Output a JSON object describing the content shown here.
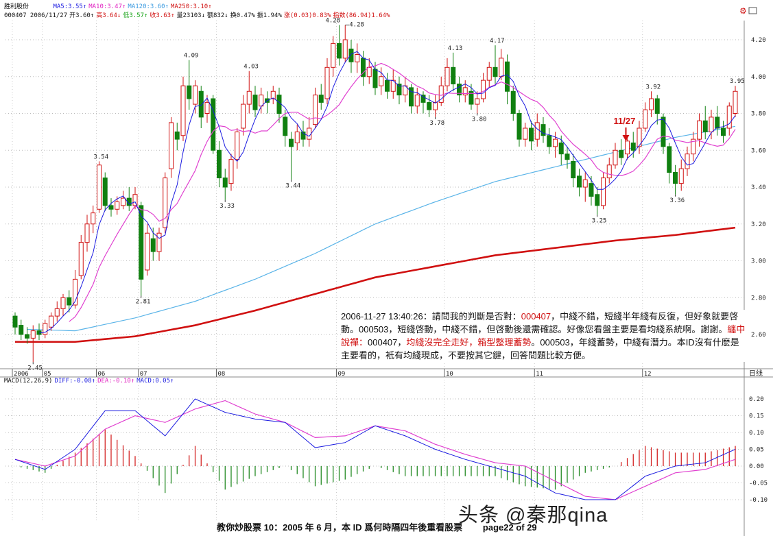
{
  "header": {
    "stock_name": "胜利股份",
    "ma_values": [
      {
        "text": "MA5:3.55↑",
        "color": "#1a1ae0"
      },
      {
        "text": "MA10:3.47↑",
        "color": "#e020c0"
      },
      {
        "text": "MA120:3.60↑",
        "color": "#3a9ae0"
      },
      {
        "text": "MA250:3.10↑",
        "color": "#d01010"
      }
    ],
    "quote_items": [
      {
        "text": "000407 2006/11/27",
        "color": "#111"
      },
      {
        "text": "开3.60↑",
        "color": "#111"
      },
      {
        "text": "高3.64↓",
        "color": "#d01010"
      },
      {
        "text": "低3.57↑",
        "color": "#10a010"
      },
      {
        "text": "收3.63↑",
        "color": "#d01010"
      },
      {
        "text": "量23103↓",
        "color": "#111"
      },
      {
        "text": "额832↓",
        "color": "#111"
      },
      {
        "text": "换0.47%",
        "color": "#111"
      },
      {
        "text": "振1.94%",
        "color": "#111"
      },
      {
        "text": "涨(0.03)0.83%",
        "color": "#d01010"
      },
      {
        "text": "指数(86.94)1.64%",
        "color": "#d01010"
      }
    ]
  },
  "macd_header": [
    {
      "text": "MACD(12,26,9)",
      "color": "#111"
    },
    {
      "text": "DIFF:-0.08↑",
      "color": "#1a1ae0"
    },
    {
      "text": "DEA:-0.10↑",
      "color": "#e020c0"
    },
    {
      "text": "MACD:0.05↑",
      "color": "#1a1ae0"
    }
  ],
  "period_label": "日线",
  "marker": {
    "text": "11/27",
    "index": 102,
    "color": "#d01010"
  },
  "note": {
    "segments": [
      {
        "text": "2006-11-27 13:40:26：請問我的判斷是否對：",
        "red": false
      },
      {
        "text": "000407",
        "red": true
      },
      {
        "text": "，中綫不錯，短綫半年綫有反復，但好象就要啓動。000503，短綫啓動，中綫不錯，但啓動後還需確認。好像您看盤主要是看均綫系統啊。謝謝。",
        "red": false
      },
      {
        "text": "纏中說禪：",
        "red": true
      },
      {
        "text": "000407，",
        "red": false
      },
      {
        "text": "均綫沒完全走好，箱型整理蓄勢",
        "red": true
      },
      {
        "text": "。000503，年綫蓄勢，中綫有潛力。本ID沒有什麽是主要看的，衹有均綫現成，不要按其它鍵，回答問題比較方便。",
        "red": false
      }
    ]
  },
  "footer": {
    "title": "教你炒股票 10：2005 年 6 月，本 ID 爲何時隔四年後重看股票",
    "page": "page22 of 29"
  },
  "watermark": "头条 @秦那qina",
  "colors": {
    "up": "#d01010",
    "down": "#108010",
    "ma5": "#1a1ae0",
    "ma10": "#e040d0",
    "ma120": "#5ab4e8",
    "ma250": "#d01010"
  },
  "chart_data": [
    {
      "type": "candlestick",
      "ylim": [
        2.45,
        4.28
      ],
      "y_ticks": [
        "4.20",
        "4.00",
        "3.80",
        "3.60",
        "3.40",
        "3.20",
        "3.00",
        "2.80",
        "2.60"
      ],
      "x_tick_labels": [
        {
          "index": 0,
          "text": "2006"
        },
        {
          "index": 5,
          "text": "05"
        },
        {
          "index": 14,
          "text": "06"
        },
        {
          "index": 21,
          "text": "07"
        },
        {
          "index": 34,
          "text": "08"
        },
        {
          "index": 54,
          "text": "09"
        },
        {
          "index": 72,
          "text": "10"
        },
        {
          "index": 87,
          "text": "11"
        },
        {
          "index": 105,
          "text": "12"
        }
      ],
      "ohlc_format": "[open, close, high, low]",
      "ohlc": [
        [
          2.7,
          2.64,
          2.72,
          2.6
        ],
        [
          2.65,
          2.6,
          2.68,
          2.57
        ],
        [
          2.6,
          2.58,
          2.64,
          2.55
        ],
        [
          2.58,
          2.62,
          2.65,
          2.45
        ],
        [
          2.62,
          2.6,
          2.66,
          2.57
        ],
        [
          2.6,
          2.66,
          2.68,
          2.58
        ],
        [
          2.64,
          2.7,
          2.72,
          2.62
        ],
        [
          2.7,
          2.74,
          2.78,
          2.67
        ],
        [
          2.74,
          2.8,
          2.82,
          2.7
        ],
        [
          2.8,
          2.76,
          2.84,
          2.72
        ],
        [
          2.76,
          2.9,
          2.95,
          2.74
        ],
        [
          2.92,
          3.1,
          3.14,
          2.9
        ],
        [
          3.1,
          3.2,
          3.25,
          3.05
        ],
        [
          3.2,
          3.26,
          3.3,
          3.15
        ],
        [
          3.28,
          3.52,
          3.54,
          3.26
        ],
        [
          3.45,
          3.3,
          3.48,
          3.27
        ],
        [
          3.3,
          3.28,
          3.34,
          3.24
        ],
        [
          3.28,
          3.32,
          3.35,
          3.25
        ],
        [
          3.3,
          3.34,
          3.38,
          3.28
        ],
        [
          3.34,
          3.3,
          3.4,
          3.27
        ],
        [
          3.3,
          3.36,
          3.4,
          3.28
        ],
        [
          3.3,
          2.9,
          3.32,
          2.81
        ],
        [
          2.95,
          3.15,
          3.2,
          2.92
        ],
        [
          3.12,
          3.05,
          3.18,
          3.0
        ],
        [
          3.05,
          3.15,
          3.18,
          3.0
        ],
        [
          3.18,
          3.45,
          3.48,
          3.15
        ],
        [
          3.5,
          3.75,
          3.78,
          3.45
        ],
        [
          3.7,
          3.66,
          3.75,
          3.6
        ],
        [
          3.68,
          3.95,
          4.0,
          3.65
        ],
        [
          3.95,
          3.88,
          4.09,
          3.82
        ],
        [
          3.85,
          3.95,
          3.98,
          3.8
        ],
        [
          3.92,
          3.78,
          3.95,
          3.72
        ],
        [
          3.8,
          3.86,
          3.9,
          3.75
        ],
        [
          3.88,
          3.6,
          3.9,
          3.58
        ],
        [
          3.6,
          3.45,
          3.65,
          3.4
        ],
        [
          3.45,
          3.4,
          3.5,
          3.33
        ],
        [
          3.42,
          3.55,
          3.58,
          3.38
        ],
        [
          3.55,
          3.7,
          3.72,
          3.5
        ],
        [
          3.72,
          3.85,
          3.9,
          3.68
        ],
        [
          3.85,
          3.92,
          4.03,
          3.8
        ],
        [
          3.9,
          3.82,
          3.95,
          3.78
        ],
        [
          3.84,
          3.9,
          3.94,
          3.8
        ],
        [
          3.88,
          3.86,
          3.92,
          3.8
        ],
        [
          3.88,
          3.92,
          3.95,
          3.85
        ],
        [
          3.9,
          3.8,
          3.94,
          3.75
        ],
        [
          3.78,
          3.68,
          3.82,
          3.62
        ],
        [
          3.66,
          3.62,
          3.7,
          3.44
        ],
        [
          3.64,
          3.7,
          3.74,
          3.6
        ],
        [
          3.7,
          3.66,
          3.76,
          3.62
        ],
        [
          3.66,
          3.72,
          3.78,
          3.62
        ],
        [
          3.74,
          3.9,
          3.94,
          3.72
        ],
        [
          3.9,
          3.86,
          3.96,
          3.82
        ],
        [
          3.88,
          4.05,
          4.1,
          3.85
        ],
        [
          4.05,
          4.18,
          4.22,
          4.0
        ],
        [
          4.18,
          4.1,
          4.28,
          4.06
        ],
        [
          4.1,
          4.2,
          4.28,
          4.08
        ],
        [
          4.15,
          4.08,
          4.2,
          4.02
        ],
        [
          4.08,
          4.12,
          4.18,
          4.02
        ],
        [
          4.1,
          4.0,
          4.14,
          3.95
        ],
        [
          4.0,
          4.05,
          4.1,
          3.96
        ],
        [
          4.04,
          3.94,
          4.08,
          3.9
        ],
        [
          3.95,
          4.0,
          4.05,
          3.9
        ],
        [
          3.98,
          3.92,
          4.02,
          3.88
        ],
        [
          3.92,
          3.98,
          4.04,
          3.88
        ],
        [
          3.96,
          3.9,
          4.0,
          3.85
        ],
        [
          3.9,
          3.95,
          4.0,
          3.86
        ],
        [
          3.94,
          3.84,
          3.96,
          3.8
        ],
        [
          3.84,
          3.9,
          3.94,
          3.8
        ],
        [
          3.9,
          3.86,
          3.92,
          3.8
        ],
        [
          3.86,
          3.82,
          3.9,
          3.78
        ],
        [
          3.82,
          3.86,
          3.9,
          3.78
        ],
        [
          3.86,
          3.95,
          4.0,
          3.84
        ],
        [
          3.95,
          4.05,
          4.1,
          3.92
        ],
        [
          4.05,
          3.96,
          4.13,
          3.92
        ],
        [
          3.96,
          3.9,
          4.0,
          3.86
        ],
        [
          3.9,
          3.94,
          3.98,
          3.86
        ],
        [
          3.92,
          3.85,
          3.96,
          3.82
        ],
        [
          3.85,
          3.88,
          3.92,
          3.8
        ],
        [
          3.88,
          3.98,
          4.02,
          3.86
        ],
        [
          3.98,
          4.05,
          4.08,
          3.94
        ],
        [
          4.05,
          4.0,
          4.17,
          3.96
        ],
        [
          4.0,
          4.1,
          4.15,
          3.98
        ],
        [
          4.08,
          3.92,
          4.12,
          3.85
        ],
        [
          3.92,
          3.8,
          3.95,
          3.76
        ],
        [
          3.8,
          3.66,
          3.82,
          3.62
        ],
        [
          3.66,
          3.72,
          3.75,
          3.62
        ],
        [
          3.72,
          3.65,
          3.76,
          3.6
        ],
        [
          3.66,
          3.75,
          3.8,
          3.62
        ],
        [
          3.74,
          3.68,
          3.78,
          3.64
        ],
        [
          3.68,
          3.62,
          3.72,
          3.58
        ],
        [
          3.62,
          3.66,
          3.7,
          3.56
        ],
        [
          3.64,
          3.58,
          3.68,
          3.52
        ],
        [
          3.58,
          3.55,
          3.62,
          3.5
        ],
        [
          3.54,
          3.45,
          3.58,
          3.4
        ],
        [
          3.46,
          3.4,
          3.5,
          3.35
        ],
        [
          3.4,
          3.44,
          3.48,
          3.32
        ],
        [
          3.42,
          3.35,
          3.46,
          3.3
        ],
        [
          3.36,
          3.3,
          3.4,
          3.25
        ],
        [
          3.3,
          3.45,
          3.48,
          3.28
        ],
        [
          3.45,
          3.52,
          3.56,
          3.42
        ],
        [
          3.52,
          3.6,
          3.64,
          3.5
        ],
        [
          3.6,
          3.56,
          3.66,
          3.52
        ],
        [
          3.58,
          3.65,
          3.68,
          3.55
        ],
        [
          3.64,
          3.6,
          3.7,
          3.56
        ],
        [
          3.62,
          3.72,
          3.76,
          3.58
        ],
        [
          3.72,
          3.82,
          3.86,
          3.7
        ],
        [
          3.82,
          3.88,
          3.92,
          3.78
        ],
        [
          3.88,
          3.8,
          3.9,
          3.74
        ],
        [
          3.78,
          3.62,
          3.8,
          3.58
        ],
        [
          3.62,
          3.48,
          3.64,
          3.42
        ],
        [
          3.48,
          3.42,
          3.52,
          3.36
        ],
        [
          3.42,
          3.5,
          3.55,
          3.38
        ],
        [
          3.5,
          3.58,
          3.62,
          3.46
        ],
        [
          3.58,
          3.66,
          3.7,
          3.54
        ],
        [
          3.66,
          3.76,
          3.8,
          3.62
        ],
        [
          3.76,
          3.7,
          3.84,
          3.66
        ],
        [
          3.7,
          3.78,
          3.82,
          3.66
        ],
        [
          3.78,
          3.72,
          3.84,
          3.68
        ],
        [
          3.72,
          3.68,
          3.76,
          3.64
        ],
        [
          3.72,
          3.84,
          3.86,
          3.68
        ],
        [
          3.8,
          3.92,
          3.95,
          3.78
        ]
      ],
      "ma_long": {
        "sample_every": 10,
        "ma120": [
          2.63,
          2.62,
          2.69,
          2.78,
          2.9,
          3.04,
          3.2,
          3.32,
          3.43,
          3.51,
          3.59,
          3.67,
          3.73
        ],
        "ma250": [
          2.56,
          2.56,
          2.59,
          2.65,
          2.73,
          2.82,
          2.91,
          2.97,
          3.03,
          3.07,
          3.11,
          3.14,
          3.18
        ]
      },
      "price_labels": [
        {
          "index": 3,
          "price": 2.45,
          "text": "2.45",
          "pos": "below"
        },
        {
          "index": 14,
          "price": 3.54,
          "text": "3.54",
          "pos": "above"
        },
        {
          "index": 21,
          "price": 2.81,
          "text": "2.81",
          "pos": "below"
        },
        {
          "index": 29,
          "price": 4.09,
          "text": "4.09",
          "pos": "above"
        },
        {
          "index": 35,
          "price": 3.33,
          "text": "3.33",
          "pos": "below"
        },
        {
          "index": 39,
          "price": 4.03,
          "text": "4.03",
          "pos": "above"
        },
        {
          "index": 46,
          "price": 3.44,
          "text": "3.44",
          "pos": "below"
        },
        {
          "index": 54,
          "price": 4.28,
          "text": "4.28",
          "pos": "left"
        },
        {
          "index": 55,
          "price": 4.28,
          "text": "4.28",
          "pos": "right"
        },
        {
          "index": 70,
          "price": 3.78,
          "text": "3.78",
          "pos": "below"
        },
        {
          "index": 73,
          "price": 4.13,
          "text": "4.13",
          "pos": "above"
        },
        {
          "index": 77,
          "price": 3.8,
          "text": "3.80",
          "pos": "below"
        },
        {
          "index": 80,
          "price": 4.17,
          "text": "4.17",
          "pos": "above"
        },
        {
          "index": 97,
          "price": 3.25,
          "text": "3.25",
          "pos": "below"
        },
        {
          "index": 106,
          "price": 3.92,
          "text": "3.92",
          "pos": "above"
        },
        {
          "index": 110,
          "price": 3.36,
          "text": "3.36",
          "pos": "below"
        },
        {
          "index": 120,
          "price": 3.95,
          "text": "3.95",
          "pos": "above"
        }
      ]
    },
    {
      "type": "line+bar",
      "title": "MACD(12,26,9)",
      "ylim": [
        -0.13,
        0.24
      ],
      "y_ticks": [
        "0.20",
        "0.15",
        "0.10",
        "0.05",
        "0.00",
        "-0.05",
        "-0.10"
      ],
      "sample_every": 5,
      "diff": [
        0.02,
        -0.01,
        0.05,
        0.165,
        0.165,
        0.09,
        0.2,
        0.16,
        0.14,
        0.13,
        0.055,
        0.07,
        0.12,
        0.09,
        0.05,
        0.02,
        -0.005,
        -0.03,
        -0.08,
        -0.1,
        -0.1,
        -0.03,
        0.0,
        0.01,
        0.05
      ],
      "dea": [
        0.02,
        0.0,
        0.03,
        0.11,
        0.15,
        0.13,
        0.17,
        0.195,
        0.155,
        0.13,
        0.085,
        0.09,
        0.12,
        0.105,
        0.065,
        0.035,
        0.01,
        0.0,
        -0.045,
        -0.09,
        -0.1,
        -0.06,
        -0.02,
        -0.01,
        0.02
      ]
    }
  ]
}
